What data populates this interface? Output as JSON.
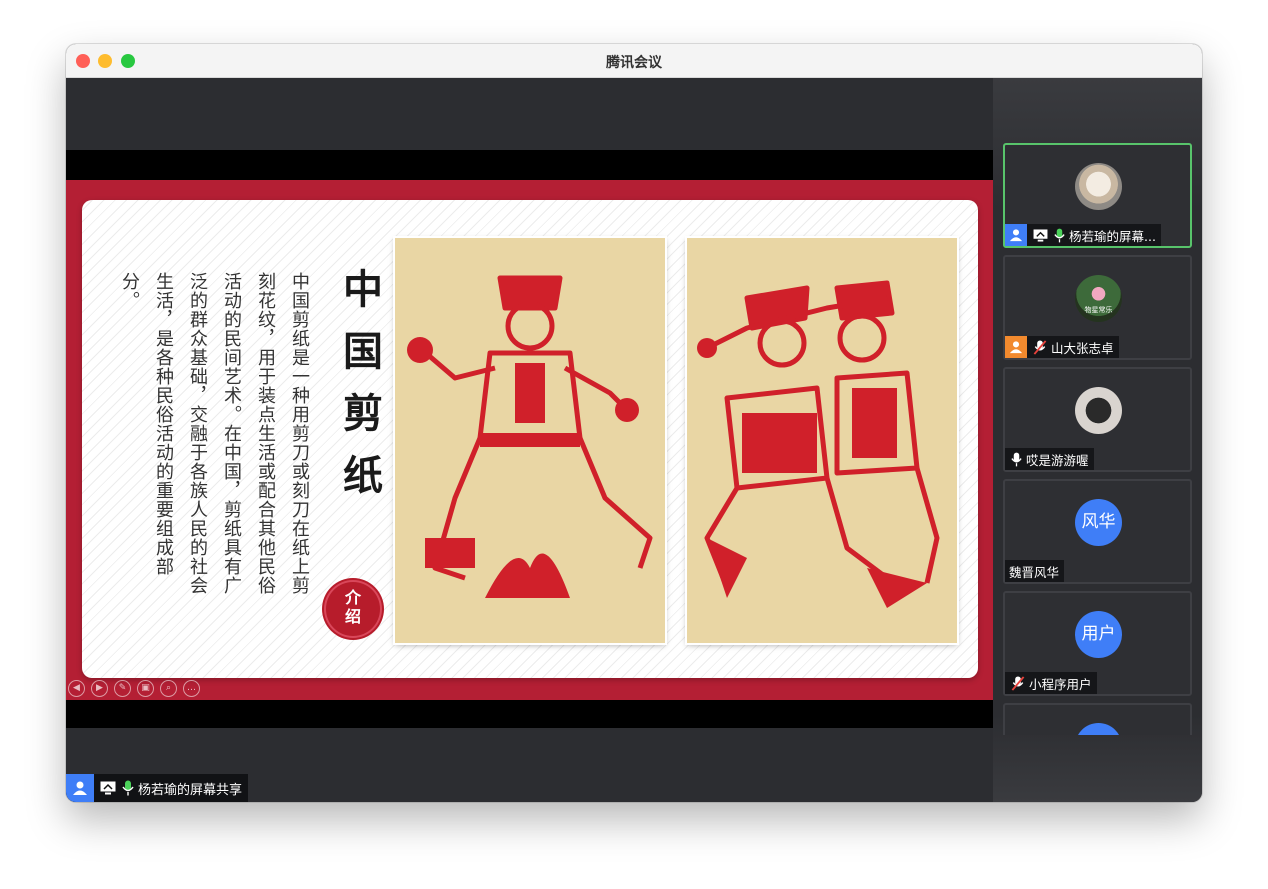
{
  "window": {
    "title": "腾讯会议"
  },
  "slide": {
    "title": "中国剪纸",
    "seal_text": "介绍",
    "body": "中国剪纸是一种用剪刀或刻刀在纸上剪刻花纹，用于装点生活或配合其他民俗活动的民间艺术。在中国，剪纸具有广泛的群众基础，交融于各族人民的社会生活，是各种民俗活动的重要组成部分。",
    "tools": [
      "◀",
      "▶",
      "✎",
      "▣",
      "⌕",
      "…"
    ]
  },
  "share_label": "杨若瑜的屏幕共享",
  "participants": [
    {
      "name": "杨若瑜的屏幕...",
      "avatar": "cat-photo",
      "active": true
    },
    {
      "name": "山大张志卓",
      "avatar": "lotus-photo",
      "avatar_caption": "物星常乐",
      "muted": true
    },
    {
      "name": "哎是游游喔",
      "avatar": "plush-photo"
    },
    {
      "name": "魏晋风华",
      "avatar_text": "风华"
    },
    {
      "name": "小程序用户",
      "avatar_text": "用户",
      "muted": true
    },
    {
      "name": "",
      "avatar_text": ""
    }
  ],
  "colors": {
    "accent": "#3f7ef7",
    "active_border": "#58c46b",
    "slide_red": "#b41f34",
    "papercut_red": "#d0202a"
  }
}
